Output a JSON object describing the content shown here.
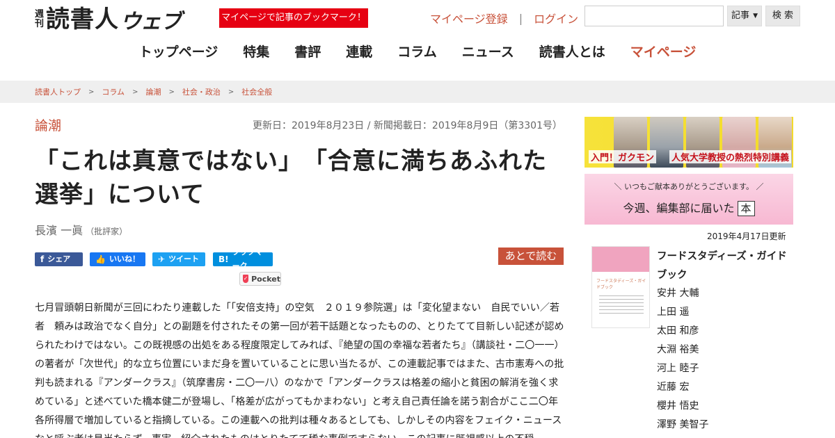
{
  "header": {
    "logo_small": "週刊",
    "logo_main": "読書人",
    "logo_web": "ウェブ",
    "bookmark_banner": "マイページで記事のブックマーク！",
    "mypage_register": "マイページ登録",
    "separator": "|",
    "login": "ログイン",
    "search": {
      "placeholder": "",
      "value": ""
    },
    "search_select": "記事",
    "search_button": "検 索"
  },
  "nav": {
    "items": [
      "トップページ",
      "特集",
      "書評",
      "連載",
      "コラム",
      "ニュース",
      "読書人とは",
      "マイページ"
    ],
    "active_index": 7
  },
  "breadcrumb": [
    "読書人トップ",
    "コラム",
    "論潮",
    "社会・政治",
    "社会全般"
  ],
  "article": {
    "category": "論潮",
    "dates": "更新日：2019年8月23日 / 新聞掲載日：2019年8月9日（第3301号）",
    "title": "「これは真意ではない」　「合意に満ちあふれた選挙」について",
    "author": "長濱 一眞",
    "author_role": "（批評家）",
    "share": {
      "facebook": "シェア",
      "like": "いいね！",
      "twitter": "ツイート",
      "hatena": "ブックマーク",
      "pocket": "Pocket"
    },
    "read_later": "あとで読む",
    "body": "七月冒頭朝日新聞が三回にわたり連載した「「安倍支持」の空気　２０１９参院選」は「変化望まない　自民でいい／若者　頼みは政治でなく自分」との副題を付されたその第一回が若干話題となったものの、とりたてて目新しい記述が認められたわけではない。この既視感の出処をある程度限定してみれば、『絶望の国の幸福な若者たち』（講談社・二〇一一）の著者が「次世代」的な立ち位置にいまだ身を置いていることに思い当たるが、この連載記事ではまた、古市憲寿への批判も読まれる『アンダークラス』（筑摩書房・二〇一八）のなかで「アンダークラスは格差の縮小と貧困の解消を強く求めている」と述べていた橋本健二が登場し、「格差が広がってもかまわない」と考え自己責任論を諾う割合がここ二〇年各所得層で増加していると指摘している。この連載への批判は種々あるとしても、しかしその内容をフェイク・ニュースなと呼ぶ者は見当たらず、事実、紹介されたものはとりたてて稀な事例ですらない。この記事に既視感以上の不穏"
  },
  "sidebar": {
    "banner1": {
      "caption_left": "入門！ガクモン",
      "caption_right": "人気大学教授の熱烈特別講義"
    },
    "banner2": {
      "line1": "＼ いつもご献本ありがとうございます。 ／",
      "line2": "今週、編集部に届いた",
      "book_label": "本"
    },
    "update_date": "2019年4月17日更新",
    "book": {
      "title": "フードスタディーズ・ガイドブック",
      "cover_title": "フードスタディーズ・ガイドブック",
      "authors": [
        "安井 大輔",
        "上田 遥",
        "太田 和彦",
        "大淵 裕美",
        "河上 睦子",
        "近藤 宏",
        "櫻井 悟史",
        "澤野 美智子"
      ]
    }
  },
  "colors": {
    "accent": "#c8523a",
    "banner_red": "#e60012",
    "facebook": "#3b5998",
    "twitter": "#1da1f2",
    "hatena": "#008fde"
  },
  "icons": [
    "facebook-icon",
    "like-icon",
    "twitter-icon",
    "hatena-icon",
    "pocket-icon",
    "chevron-right-icon",
    "caret-down-icon"
  ]
}
